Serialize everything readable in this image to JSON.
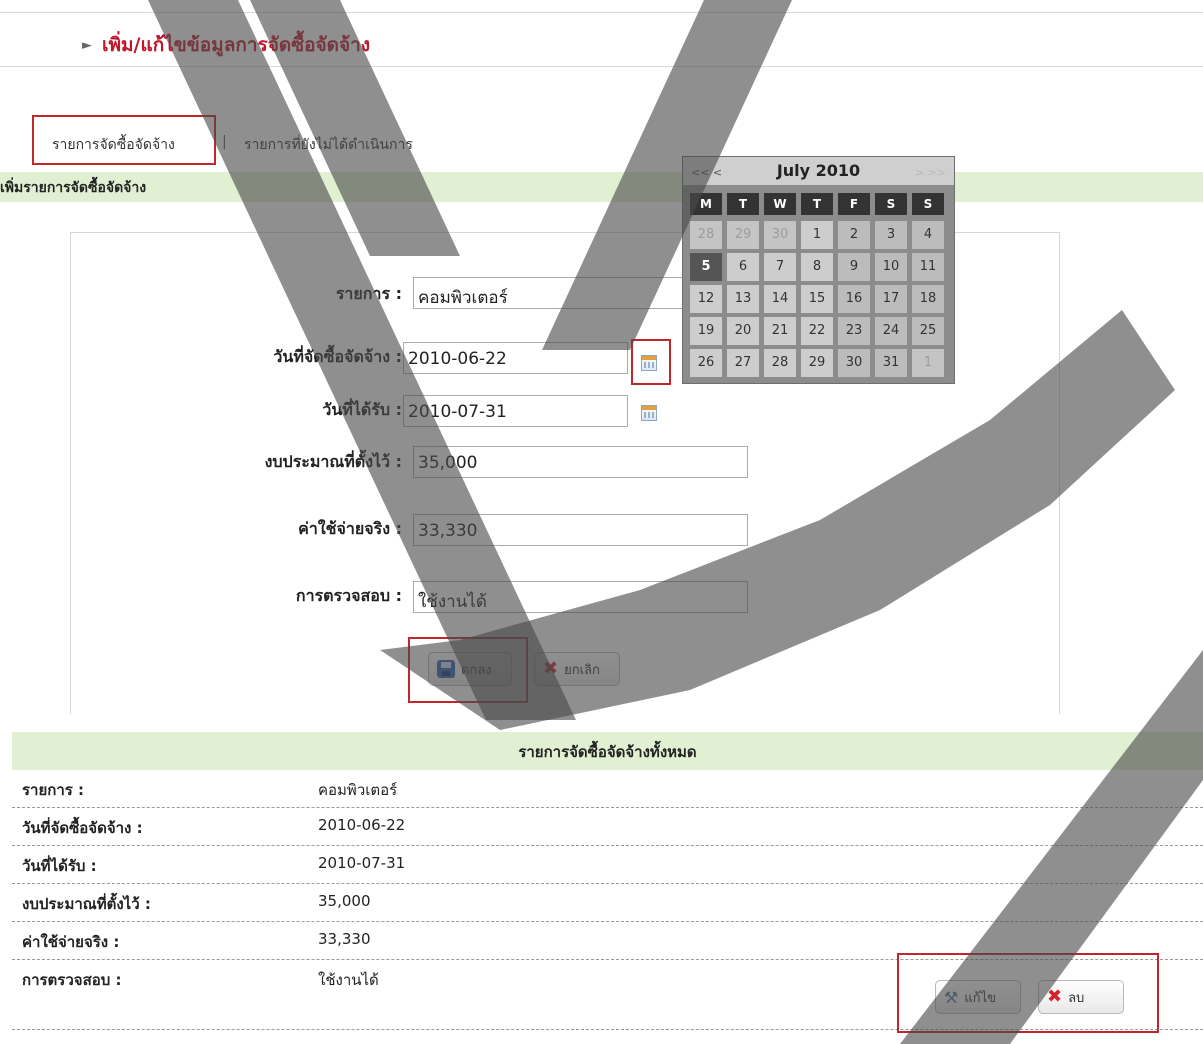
{
  "page": {
    "title": "เพิ่ม/แก้ไขข้อมูลการจัดซื้อจัดจ้าง"
  },
  "tabs": [
    {
      "label": "รายการจัดซื้อจัดจ้าง"
    },
    {
      "separator": "|"
    },
    {
      "label": "รายการที่ยังไม่ได้ดำเนินการ"
    }
  ],
  "section": {
    "title": "เพิ่มรายการจัดซื้อจัดจ้าง"
  },
  "form": {
    "item_label": "รายการ :",
    "item_value": "คอมพิวเตอร์",
    "purchase_date_label": "วันที่จัดซื้อจัดจ้าง :",
    "purchase_date_value": "2010-06-22",
    "received_date_label": "วันที่ได้รับ :",
    "received_date_value": "2010-07-31",
    "budget_label": "งบประมาณที่ตั้งไว้ :",
    "budget_value": "35,000",
    "actual_cost_label": "ค่าใช้จ่ายจริง :",
    "actual_cost_value": "33,330",
    "inspection_label": "การตรวจสอบ :",
    "inspection_value": "ใช้งานได้",
    "ok_label": "ตกลง",
    "cancel_label": "ยกเลิก"
  },
  "calendar": {
    "prev": "<< <",
    "next": "> >>",
    "title": "July 2010",
    "weekdays": [
      "M",
      "T",
      "W",
      "T",
      "F",
      "S",
      "S"
    ],
    "weeks": [
      [
        "28",
        "29",
        "30",
        "1",
        "2",
        "3",
        "4"
      ],
      [
        "5",
        "6",
        "7",
        "8",
        "9",
        "10",
        "11"
      ],
      [
        "12",
        "13",
        "14",
        "15",
        "16",
        "17",
        "18"
      ],
      [
        "19",
        "20",
        "21",
        "22",
        "23",
        "24",
        "25"
      ],
      [
        "26",
        "27",
        "28",
        "29",
        "30",
        "31",
        "1"
      ]
    ],
    "today": "5"
  },
  "summary": {
    "title": "รายการจัดซื้อจัดจ้างทั้งหมด",
    "rows": [
      {
        "label": "รายการ :",
        "value": "คอมพิวเตอร์"
      },
      {
        "label": "วันที่จัดซื้อจัดจ้าง :",
        "value": "2010-06-22"
      },
      {
        "label": "วันที่ได้รับ :",
        "value": "2010-07-31"
      },
      {
        "label": "งบประมาณที่ตั้งไว้ :",
        "value": "35,000"
      },
      {
        "label": "ค่าใช้จ่ายจริง :",
        "value": "33,330"
      },
      {
        "label": "การตรวจสอบ :",
        "value": "ใช้งานได้"
      }
    ],
    "edit_label": "แก้ไข",
    "delete_label": "ลบ"
  }
}
